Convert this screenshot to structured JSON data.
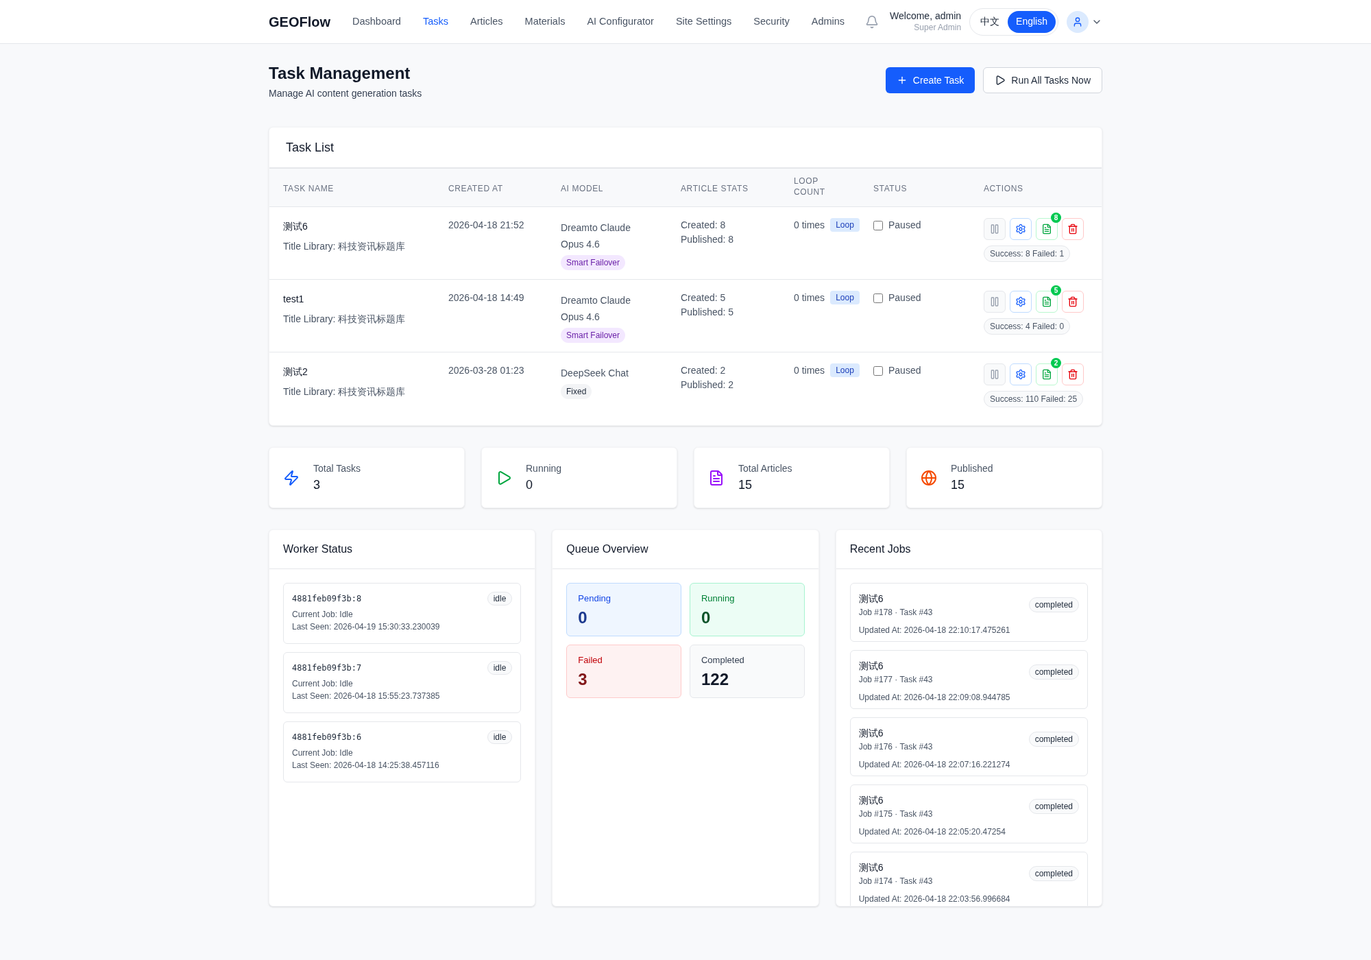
{
  "header": {
    "logo": "GEOFlow",
    "nav": [
      {
        "label": "Dashboard",
        "selected": false
      },
      {
        "label": "Tasks",
        "selected": true
      },
      {
        "label": "Articles",
        "selected": false
      },
      {
        "label": "Materials",
        "selected": false
      },
      {
        "label": "AI Configurator",
        "selected": false
      },
      {
        "label": "Site Settings",
        "selected": false
      },
      {
        "label": "Security",
        "selected": false
      },
      {
        "label": "Admins",
        "selected": false
      }
    ],
    "welcome": "Welcome, admin",
    "role": "Super Admin",
    "languages": [
      {
        "label": "中文",
        "selected": false
      },
      {
        "label": "English",
        "selected": true
      }
    ]
  },
  "page": {
    "title": "Task Management",
    "subtitle": "Manage AI content generation tasks",
    "buttons": [
      {
        "label": "Create Task",
        "kind": "primary"
      },
      {
        "label": "Run All Tasks Now",
        "kind": "secondary"
      }
    ]
  },
  "task_list": {
    "title": "Task List",
    "columns": [
      "TASK NAME",
      "CREATED AT",
      "AI MODEL",
      "ARTICLE STATS",
      "LOOP COUNT",
      "STATUS",
      "ACTIONS"
    ],
    "rows": [
      {
        "name": "测试6",
        "library": "Title Library: 科技资讯标题库",
        "created_at": "2026-04-18 21:52",
        "model": "Dreamto Claude Opus 4.6",
        "model_tag": {
          "label": "Smart Failover",
          "kind": "failover"
        },
        "created": "Created: 8",
        "published": "Published: 8",
        "loop_count": "0 times",
        "loop_tag": "Loop",
        "status": {
          "label": "Paused",
          "checked": false
        },
        "article_badge": "8",
        "result": "Success: 8 Failed: 1"
      },
      {
        "name": "test1",
        "library": "Title Library: 科技资讯标题库",
        "created_at": "2026-04-18 14:49",
        "model": "Dreamto Claude Opus 4.6",
        "model_tag": {
          "label": "Smart Failover",
          "kind": "failover"
        },
        "created": "Created: 5",
        "published": "Published: 5",
        "loop_count": "0 times",
        "loop_tag": "Loop",
        "status": {
          "label": "Paused",
          "checked": false
        },
        "article_badge": "5",
        "result": "Success: 4 Failed: 0"
      },
      {
        "name": "测试2",
        "library": "Title Library: 科技资讯标题库",
        "created_at": "2026-03-28 01:23",
        "model": "DeepSeek Chat",
        "model_tag": {
          "label": "Fixed",
          "kind": "fixed"
        },
        "created": "Created: 2",
        "published": "Published: 2",
        "loop_count": "0 times",
        "loop_tag": "Loop",
        "status": {
          "label": "Paused",
          "checked": false
        },
        "article_badge": "2",
        "result": "Success: 110 Failed: 25"
      }
    ]
  },
  "stats": [
    {
      "kind": "tasks",
      "label": "Total Tasks",
      "value": "3"
    },
    {
      "kind": "running",
      "label": "Running",
      "value": "0"
    },
    {
      "kind": "articles",
      "label": "Total Articles",
      "value": "15"
    },
    {
      "kind": "published",
      "label": "Published",
      "value": "15"
    }
  ],
  "worker_status": {
    "title": "Worker Status",
    "workers": [
      {
        "id": "4881feb09f3b:8",
        "state": "idle",
        "job": "Current Job: Idle",
        "last_seen": "Last Seen: 2026-04-19 15:30:33.230039"
      },
      {
        "id": "4881feb09f3b:7",
        "state": "idle",
        "job": "Current Job: Idle",
        "last_seen": "Last Seen: 2026-04-18 15:55:23.737385"
      },
      {
        "id": "4881feb09f3b:6",
        "state": "idle",
        "job": "Current Job: Idle",
        "last_seen": "Last Seen: 2026-04-18 14:25:38.457116"
      }
    ]
  },
  "queue_overview": {
    "title": "Queue Overview",
    "tiles": [
      {
        "kind": "pending",
        "label": "Pending",
        "value": "0"
      },
      {
        "kind": "running",
        "label": "Running",
        "value": "0"
      },
      {
        "kind": "failed",
        "label": "Failed",
        "value": "3"
      },
      {
        "kind": "completed",
        "label": "Completed",
        "value": "122"
      }
    ]
  },
  "recent_jobs": {
    "title": "Recent Jobs",
    "jobs": [
      {
        "name": "测试6",
        "meta": "Job #178 · Task #43",
        "status": "completed",
        "updated": "Updated At: 2026-04-18 22:10:17.475261"
      },
      {
        "name": "测试6",
        "meta": "Job #177 · Task #43",
        "status": "completed",
        "updated": "Updated At: 2026-04-18 22:09:08.944785"
      },
      {
        "name": "测试6",
        "meta": "Job #176 · Task #43",
        "status": "completed",
        "updated": "Updated At: 2026-04-18 22:07:16.221274"
      },
      {
        "name": "测试6",
        "meta": "Job #175 · Task #43",
        "status": "completed",
        "updated": "Updated At: 2026-04-18 22:05:20.47254"
      },
      {
        "name": "测试6",
        "meta": "Job #174 · Task #43",
        "status": "completed",
        "updated": "Updated At: 2026-04-18 22:03:56.996684"
      }
    ]
  }
}
